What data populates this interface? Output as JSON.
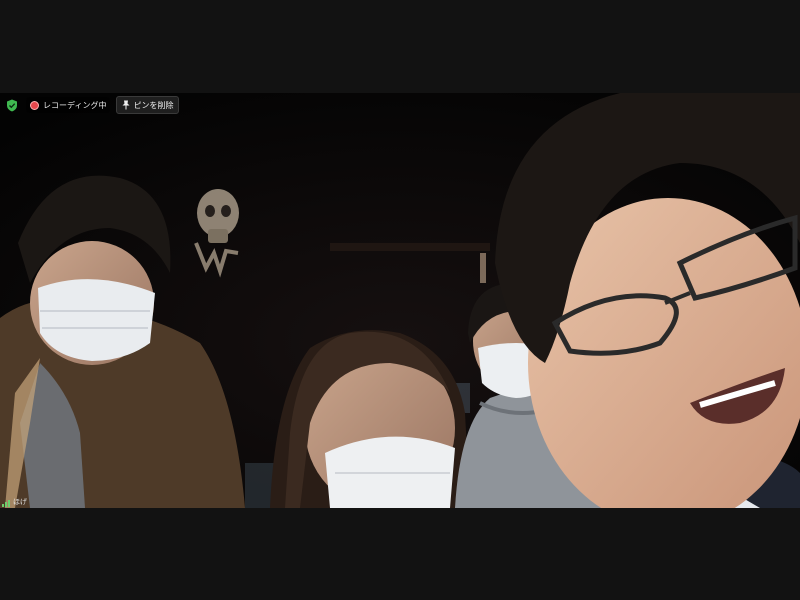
{
  "status_bar": {
    "security_icon": "shield-check-icon",
    "recording_label": "レコーディング中",
    "pin_button_label": "ピンを削除",
    "pin_icon": "pin-icon"
  },
  "participant": {
    "name": "ほげ",
    "signal_icon": "signal-strength-icon"
  },
  "colors": {
    "security_green": "#3fb950",
    "recording_red": "#e5484d",
    "background": "#121212"
  }
}
